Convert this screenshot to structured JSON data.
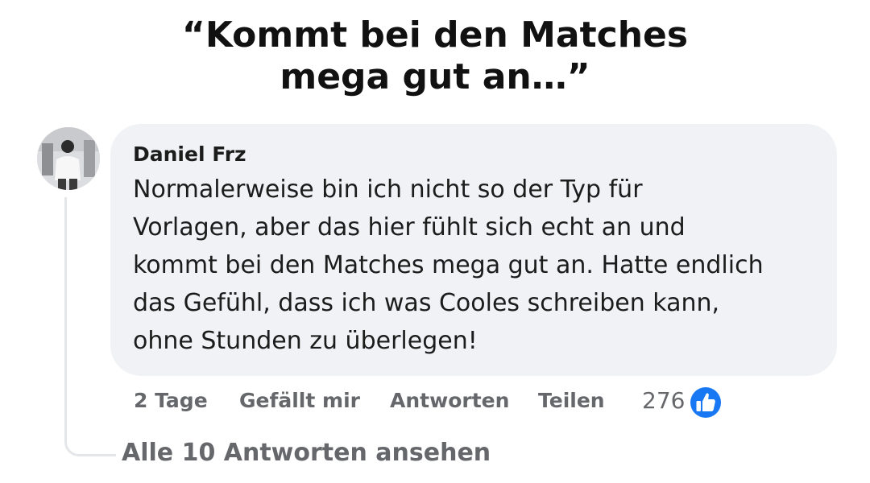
{
  "headline": {
    "line1": "“Kommt bei den Matches",
    "line2": "mega gut an…”"
  },
  "comment": {
    "author": "Daniel Frz",
    "text_lines": [
      "Normalerweise bin ich nicht so der Typ für",
      "Vorlagen, aber das hier fühlt sich echt an und",
      "kommt bei den Matches mega gut an. Hatte endlich",
      "das Gefühl, dass ich was Cooles schreiben kann,",
      "ohne Stunden zu überlegen!"
    ],
    "avatar_icon": "profile-photo",
    "bubble_color": "#f0f2f5"
  },
  "actions": {
    "time": "2 Tage",
    "like": "Gefällt mir",
    "reply": "Antworten",
    "share": "Teilen",
    "reaction_count": "276",
    "reaction_icon": "thumbs-up-icon",
    "reaction_color": "#1877f2"
  },
  "replies": {
    "view_all": "Alle 10 Antworten ansehen"
  }
}
